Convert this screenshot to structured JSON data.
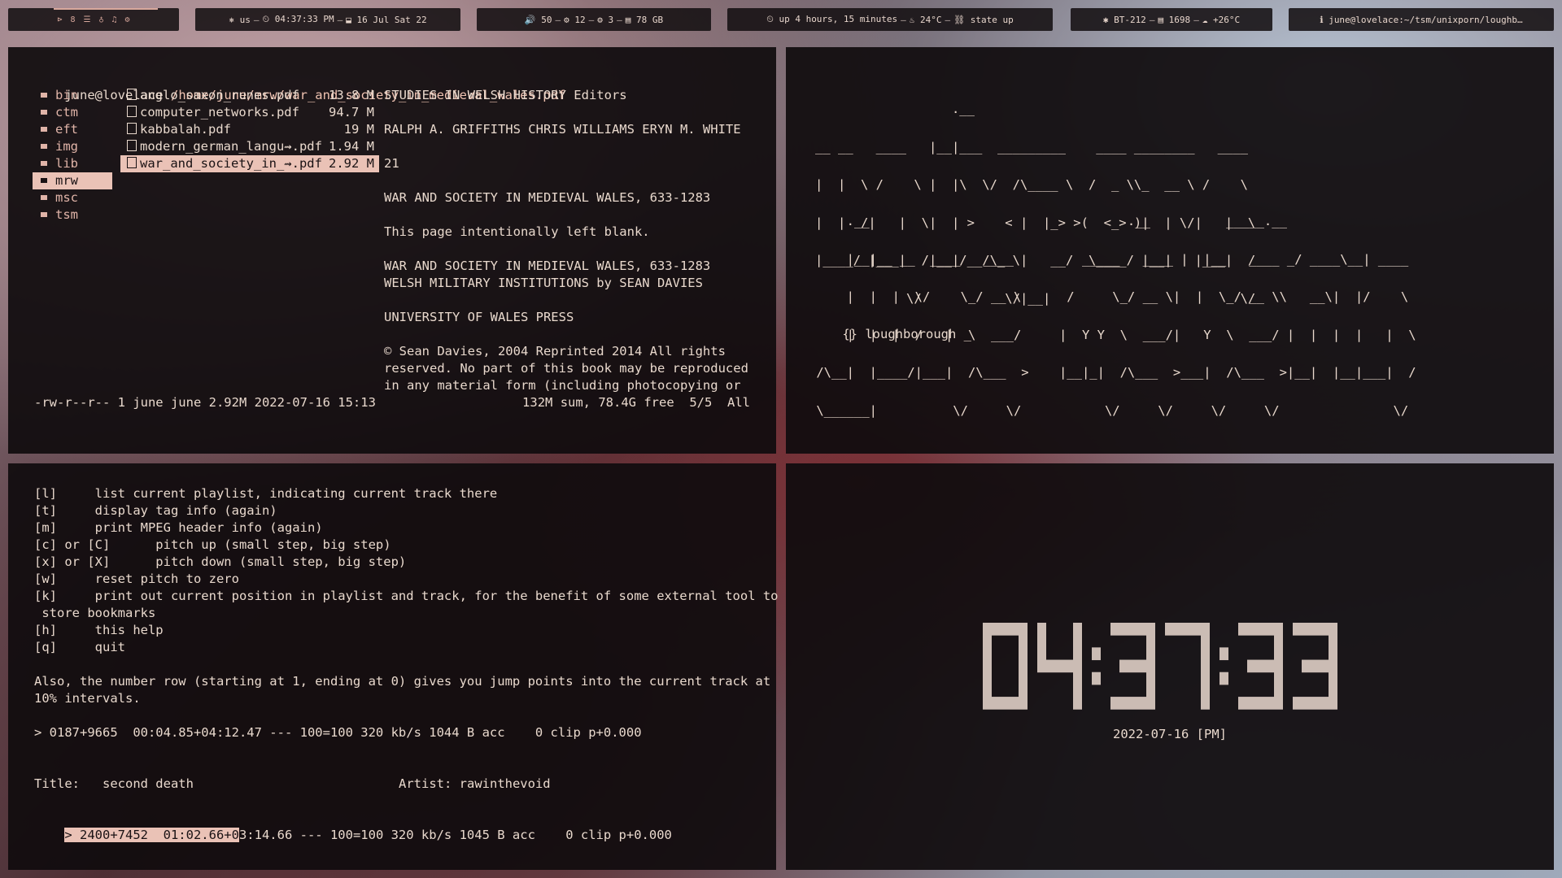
{
  "bar": {
    "workspaces": [
      "⊳",
      "8",
      "☰",
      "♁",
      "♫",
      "⚙"
    ],
    "time_section": [
      "⎈ us",
      "⏲ 04:37:33 PM",
      "⬓ 16 Jul Sat 22"
    ],
    "sys_section": [
      "🔊 50",
      "⚙ 12",
      "⚙ 3",
      "▤ 78 GB"
    ],
    "uptime_section": [
      "⏲ up 4 hours, 15 minutes",
      "♨ 24°C",
      "⛓ state up"
    ],
    "sensor_section": [
      "✱ BT-212",
      "▤ 1698",
      "☁ +26°C"
    ],
    "title_section": "ℹ june@lovelace:~/tsm/unixporn/loughb…"
  },
  "file_manager": {
    "header_user": "june@lovelace",
    "header_path": "/home/june/mrw/war_and_society_in_medieval_wales.pdf",
    "dirs": [
      "bin",
      "ctm",
      "eft",
      "img",
      "lib",
      "mrw",
      "msc",
      "tsm"
    ],
    "selected_dir_index": 5,
    "files": [
      {
        "name": "anglo_saxon_runes.pdf",
        "size": "13.8 M"
      },
      {
        "name": "computer_networks.pdf",
        "size": "94.7 M"
      },
      {
        "name": "kabbalah.pdf",
        "size": "19 M"
      },
      {
        "name": "modern_german_langu⇝.pdf",
        "size": "1.94 M"
      },
      {
        "name": "war_and_society_in_⇝.pdf",
        "size": "2.92 M"
      }
    ],
    "selected_file_index": 4,
    "preview": [
      "STUDIES IN WELSH HISTORY Editors",
      "",
      "RALPH A. GRIFFITHS CHRIS WILLIAMS ERYN M. WHITE",
      "",
      "21",
      "",
      "",
      "WAR AND SOCIETY IN MEDIEVAL WALES, 633-1283",
      "",
      "This page intentionally left blank.",
      "",
      "WAR AND SOCIETY IN MEDIEVAL WALES, 633-1283",
      "WELSH MILITARY INSTITUTIONS by SEAN DAVIES",
      "",
      "UNIVERSITY OF WALES PRESS",
      "",
      "© Sean Davies, 2004 Reprinted 2014 All rights",
      "reserved. No part of this book may be reproduced",
      "in any material form (including photocopying or"
    ],
    "status_left": "-rw-r--r-- 1 june june 2.92M 2022-07-16 15:13",
    "status_right": "132M sum, 78.4G free  5/5  All"
  },
  "banner": {
    "ascii_lines_1": [
      "                  .__",
      "__ __   ____   |__|___  _________    ____ ________   ____",
      "|  |  \\ /    \\ |  |\\  \\/  /\\____ \\  /  _ \\\\_  __ \\ /    \\",
      "|  |  /|   |  \\|  | >    < |  |_> >(  <_> )|  | \\/|   |  \\",
      "|____/ |___|  /|__|/__/\\_ \\|   __/  \\____/ |__|   |___|  /",
      "            \\/           \\/|__|                         \\/"
    ],
    "ascii_lines_2": [
      "     .__                                  .__          _____.__",
      "     |__|__ __  ____   ____         _____   ____ |  |__   ____ _/ ____\\__| ____",
      "     |  |  |  \\/    \\_/ __ \\      /     \\_/ __ \\|  |  \\_/ __ \\\\   __\\|  |/    \\",
      "     |  |  |  /   |  \\  ___/     |  Y Y  \\  ___/|   Y  \\  ___/ |  |  |  |   |  \\",
      " /\\__|  |____/|___|  /\\___  >    |__|_|  /\\___  >___|  /\\___  >|__|  |__|___|  /",
      " \\______|          \\/     \\/           \\/     \\/     \\/     \\/               \\/"
    ],
    "prompt_icon": "{}",
    "prompt_text": "loughborough _"
  },
  "player": {
    "help_lines": [
      "[l]     list current playlist, indicating current track there",
      "[t]     display tag info (again)",
      "[m]     print MPEG header info (again)",
      "[c] or [C]      pitch up (small step, big step)",
      "[x] or [X]      pitch down (small step, big step)",
      "[w]     reset pitch to zero",
      "[k]     print out current position in playlist and track, for the benefit of some external tool to",
      " store bookmarks",
      "[h]     this help",
      "[q]     quit",
      "",
      "Also, the number row (starting at 1, ending at 0) gives you jump points into the current track at",
      "10% intervals."
    ],
    "status_1": "> 0187+9665  00:04.85+04:12.47 --- 100=100 320 kb/s 1044 B acc    0 clip p+0.000",
    "title_label": "Title:   second death",
    "artist_label": "Artist: rawinthevoid",
    "status_2_highlight": "> 2400+7452  01:02.66+0",
    "status_2_rest": "3:14.66 --- 100=100 320 kb/s 1045 B acc    0 clip p+0.000"
  },
  "clock": {
    "time": "04:37:33",
    "date": "2022-07-16 [PM]",
    "color": "#cbbcb4"
  }
}
